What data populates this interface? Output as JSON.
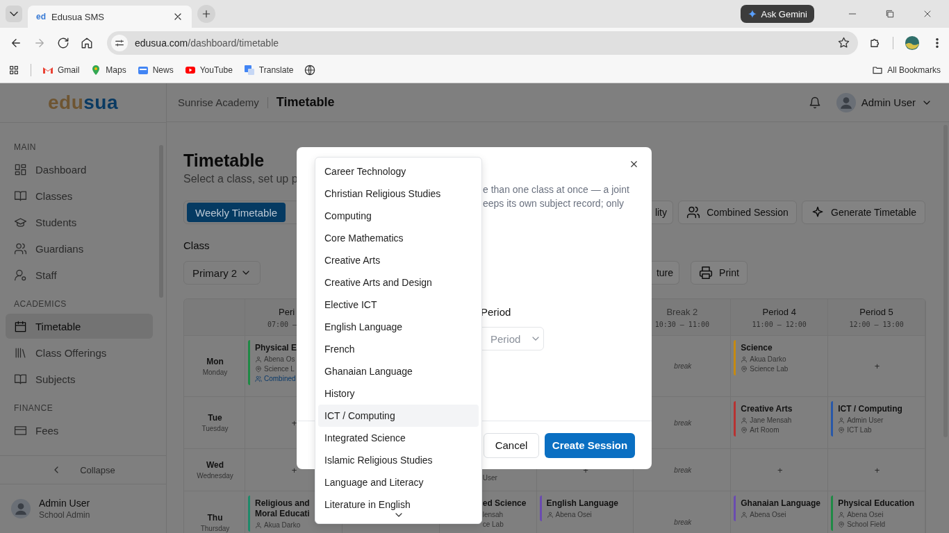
{
  "browser": {
    "tabs": [
      {
        "favicon": "ed",
        "title": "Edusua SMS",
        "selected": true
      }
    ],
    "gemini": "Ask Gemini",
    "url_host": "edusua.com",
    "url_path": "/dashboard/timetable",
    "bookmarks": [
      "Gmail",
      "Maps",
      "News",
      "YouTube",
      "Translate"
    ],
    "all_bookmarks": "All Bookmarks"
  },
  "logo": [
    "edu",
    "sua"
  ],
  "header": {
    "school": "Sunrise Academy",
    "page": "Timetable",
    "user": "Admin User"
  },
  "sidebar": {
    "sections": [
      {
        "label": "MAIN",
        "items": [
          {
            "label": "Dashboard",
            "selected": false
          },
          {
            "label": "Classes",
            "selected": false
          },
          {
            "label": "Students",
            "selected": false
          },
          {
            "label": "Guardians",
            "selected": false
          },
          {
            "label": "Staff",
            "selected": false
          }
        ]
      },
      {
        "label": "ACADEMICS",
        "items": [
          {
            "label": "Timetable",
            "selected": true
          },
          {
            "label": "Class Offerings",
            "selected": false
          },
          {
            "label": "Subjects",
            "selected": false
          }
        ]
      },
      {
        "label": "FINANCE",
        "items": [
          {
            "label": "Fees",
            "selected": false
          }
        ]
      }
    ],
    "collapse": "Collapse",
    "user": {
      "name": "Admin User",
      "role": "School Admin"
    }
  },
  "page": {
    "title": "Timetable",
    "subtitle": "Select a class, set up p",
    "tabs": [
      {
        "label": "Weekly Timetable",
        "selected": true
      }
    ],
    "actions": [
      {
        "label": "lity",
        "kind": "cut"
      },
      {
        "label": "Combined Session",
        "kind": "users"
      },
      {
        "label": "Generate Timetable",
        "kind": "sparkle"
      }
    ],
    "class_label": "Class",
    "class_value": "Primary 2",
    "actions2": [
      {
        "label": "ture",
        "kind": "cut"
      },
      {
        "label": "Print",
        "kind": "printer"
      }
    ]
  },
  "table": {
    "columns": [
      {
        "kind": "period",
        "label": "Peri",
        "time": "07:00 –"
      },
      {
        "kind": "covered"
      },
      {
        "kind": "covered"
      },
      {
        "kind": "covered"
      },
      {
        "kind": "break",
        "label": "Break 2",
        "time": "10:30 – 11:00"
      },
      {
        "kind": "period",
        "label": "Period 4",
        "time": "11:00 – 12:00"
      },
      {
        "kind": "period",
        "label": "Period 5",
        "time": "12:00 – 13:00"
      }
    ],
    "rows": [
      {
        "day": "Mon",
        "full": "Monday",
        "cells": [
          {
            "kind": "card",
            "title": "Physical E",
            "teacher": "Abena Os",
            "room": "Science L",
            "combined": "Combined",
            "color": "#1f8a45"
          },
          {
            "kind": "covered"
          },
          {
            "kind": "covered"
          },
          {
            "kind": "covered"
          },
          {
            "kind": "break",
            "text": "break"
          },
          {
            "kind": "card",
            "title": "Science",
            "teacher": "Akua Darko",
            "room": "Science Lab",
            "color": "#c68a10"
          },
          {
            "kind": "empty",
            "text": "+"
          }
        ]
      },
      {
        "day": "Tue",
        "full": "Tuesday",
        "cells": [
          {
            "kind": "empty",
            "text": "+"
          },
          {
            "kind": "covered"
          },
          {
            "kind": "covered"
          },
          {
            "kind": "covered"
          },
          {
            "kind": "break",
            "text": "break"
          },
          {
            "kind": "card",
            "title": "Creative Arts",
            "teacher": "Jane Mensah",
            "room": "Art Room",
            "color": "#b83232"
          },
          {
            "kind": "card",
            "title": "ICT / Computing",
            "teacher": "Admin User",
            "room": "ICT Lab",
            "color": "#2858a8"
          }
        ]
      },
      {
        "day": "Wed",
        "full": "Wednesday",
        "cells": [
          {
            "kind": "empty",
            "text": "+"
          },
          {
            "kind": "covered"
          },
          {
            "kind": "fragment",
            "lines": [
              "User"
            ]
          },
          {
            "kind": "empty",
            "text": "+"
          },
          {
            "kind": "break",
            "text": "break"
          },
          {
            "kind": "empty",
            "text": "+"
          },
          {
            "kind": "empty",
            "text": "+"
          }
        ]
      },
      {
        "day": "Thu",
        "full": "Thursday",
        "cells": [
          {
            "kind": "card",
            "title": "Religious and Moral Educati",
            "teacher": "Akua Darko",
            "color": "#1f8a6a"
          },
          {
            "kind": "covered"
          },
          {
            "kind": "fragment",
            "title": "ed Science",
            "lines": [
              "lensah",
              "ce Lab"
            ]
          },
          {
            "kind": "card",
            "title": "English Language",
            "teacher": "Abena Osei",
            "color": "#6a4bb0"
          },
          {
            "kind": "break",
            "text": "break"
          },
          {
            "kind": "card",
            "title": "Ghanaian Language",
            "teacher": "Abena Osei",
            "color": "#6a4bb0"
          },
          {
            "kind": "card",
            "title": "Physical Education",
            "teacher": "Abena Osei",
            "room": "School Field",
            "color": "#1f8a45"
          }
        ]
      }
    ]
  },
  "dialog": {
    "description": [
      "e than one class at once — a joint",
      "eeps its own subject record; only"
    ],
    "period_label": "Period",
    "period_placeholder": "Period",
    "cancel": "Cancel",
    "create": "Create Session"
  },
  "dropdown": {
    "options": [
      {
        "label": "Career Technology",
        "selected": false
      },
      {
        "label": "Christian Religious Studies",
        "selected": false
      },
      {
        "label": "Computing",
        "selected": false
      },
      {
        "label": "Core Mathematics",
        "selected": false
      },
      {
        "label": "Creative Arts",
        "selected": false
      },
      {
        "label": "Creative Arts and Design",
        "selected": false
      },
      {
        "label": "Elective ICT",
        "selected": false
      },
      {
        "label": "English Language",
        "selected": false
      },
      {
        "label": "French",
        "selected": false
      },
      {
        "label": "Ghanaian Language",
        "selected": false
      },
      {
        "label": "History",
        "selected": false
      },
      {
        "label": "ICT / Computing",
        "selected": true
      },
      {
        "label": "Integrated Science",
        "selected": false
      },
      {
        "label": "Islamic Religious Studies",
        "selected": false
      },
      {
        "label": "Language and Literacy",
        "selected": false
      },
      {
        "label": "Literature in English",
        "selected": false
      }
    ]
  }
}
